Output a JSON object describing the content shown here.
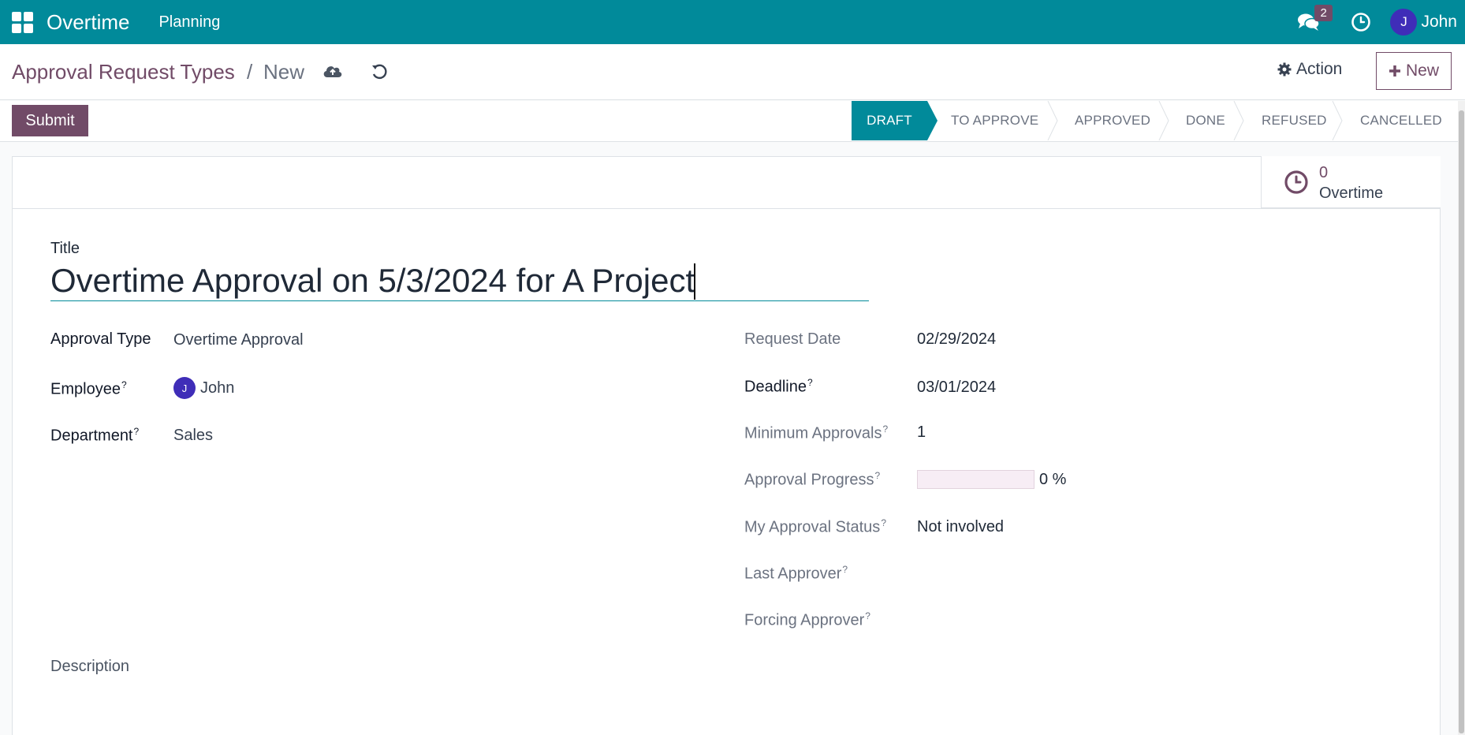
{
  "navbar": {
    "app_name": "Overtime",
    "menu_planning": "Planning",
    "messages_count": "2",
    "user_initial": "J",
    "user_name": "John",
    "accent_color": "#018a9a"
  },
  "control_panel": {
    "breadcrumb_parent": "Approval Request Types",
    "breadcrumb_separator": "/",
    "breadcrumb_current": "New",
    "save_icon": "cloud-upload-icon",
    "discard_icon": "undo-icon",
    "action_label": "Action",
    "new_label": "New"
  },
  "statusbar": {
    "submit_label": "Submit",
    "stages": [
      "DRAFT",
      "TO APPROVE",
      "APPROVED",
      "DONE",
      "REFUSED",
      "CANCELLED"
    ],
    "active_stage": "DRAFT"
  },
  "smart_button": {
    "value": "0",
    "label": "Overtime",
    "icon": "clock-icon"
  },
  "form": {
    "title_label": "Title",
    "title_value": "Overtime Approval on 5/3/2024 for A Project",
    "left": {
      "approval_type_label": "Approval Type",
      "approval_type_value": "Overtime Approval",
      "employee_label": "Employee",
      "employee_initial": "J",
      "employee_value": "John",
      "department_label": "Department",
      "department_value": "Sales",
      "help_mark": "?"
    },
    "right": {
      "request_date_label": "Request Date",
      "request_date_value": "02/29/2024",
      "deadline_label": "Deadline",
      "deadline_value": "03/01/2024",
      "min_approvals_label": "Minimum Approvals",
      "min_approvals_value": "1",
      "progress_label": "Approval Progress",
      "progress_value": 0,
      "progress_text": "0 %",
      "my_status_label": "My Approval Status",
      "my_status_value": "Not involved",
      "last_approver_label": "Last Approver",
      "forcing_approver_label": "Forcing Approver"
    },
    "description_label": "Description"
  }
}
